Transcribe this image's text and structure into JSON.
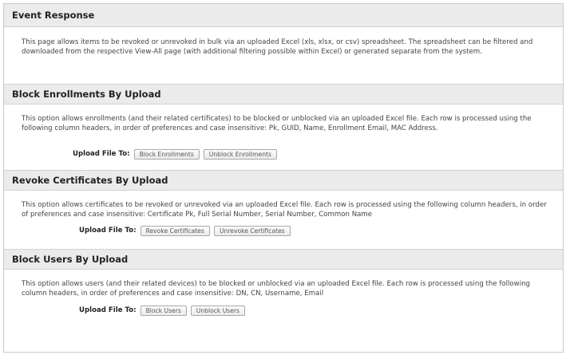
{
  "page": {
    "title": "Event Response",
    "intro": "This page allows items to be revoked or unrevoked in bulk via an uploaded Excel (xls, xlsx, or csv) spreadsheet. The spreadsheet can be filtered and downloaded from the respective View-All page (with additional filtering possible within Excel) or generated separate from the system."
  },
  "sections": [
    {
      "title": "Block Enrollments By Upload",
      "description": "This option allows enrollments (and their related certificates) to be blocked or unblocked via an uploaded Excel file. Each row is processed using the following column headers, in order of preferences and case insensitive: Pk, GUID, Name, Enrollment Email, MAC Address.",
      "upload_label": "Upload File To:",
      "buttons": [
        "Block Enrollments",
        "Unblock Enrollments"
      ]
    },
    {
      "title": "Revoke Certificates By Upload",
      "description": "This option allows certificates to be revoked or unrevoked via an uploaded Excel file. Each row is processed using the following column headers, in order of preferences and case insensitive: Certificate Pk, Full Serial Number, Serial Number, Common Name",
      "upload_label": "Upload File To:",
      "buttons": [
        "Revoke Certificates",
        "Unrevoke Certificates"
      ]
    },
    {
      "title": "Block Users By Upload",
      "description": "This option allows users (and their related devices) to be blocked or unblocked via an uploaded Excel file. Each row is processed using the following column headers, in order of preferences and case insensitive: DN, CN, Username, Email",
      "upload_label": "Upload File To:",
      "buttons": [
        "Block Users",
        "Unblock Users"
      ]
    }
  ]
}
